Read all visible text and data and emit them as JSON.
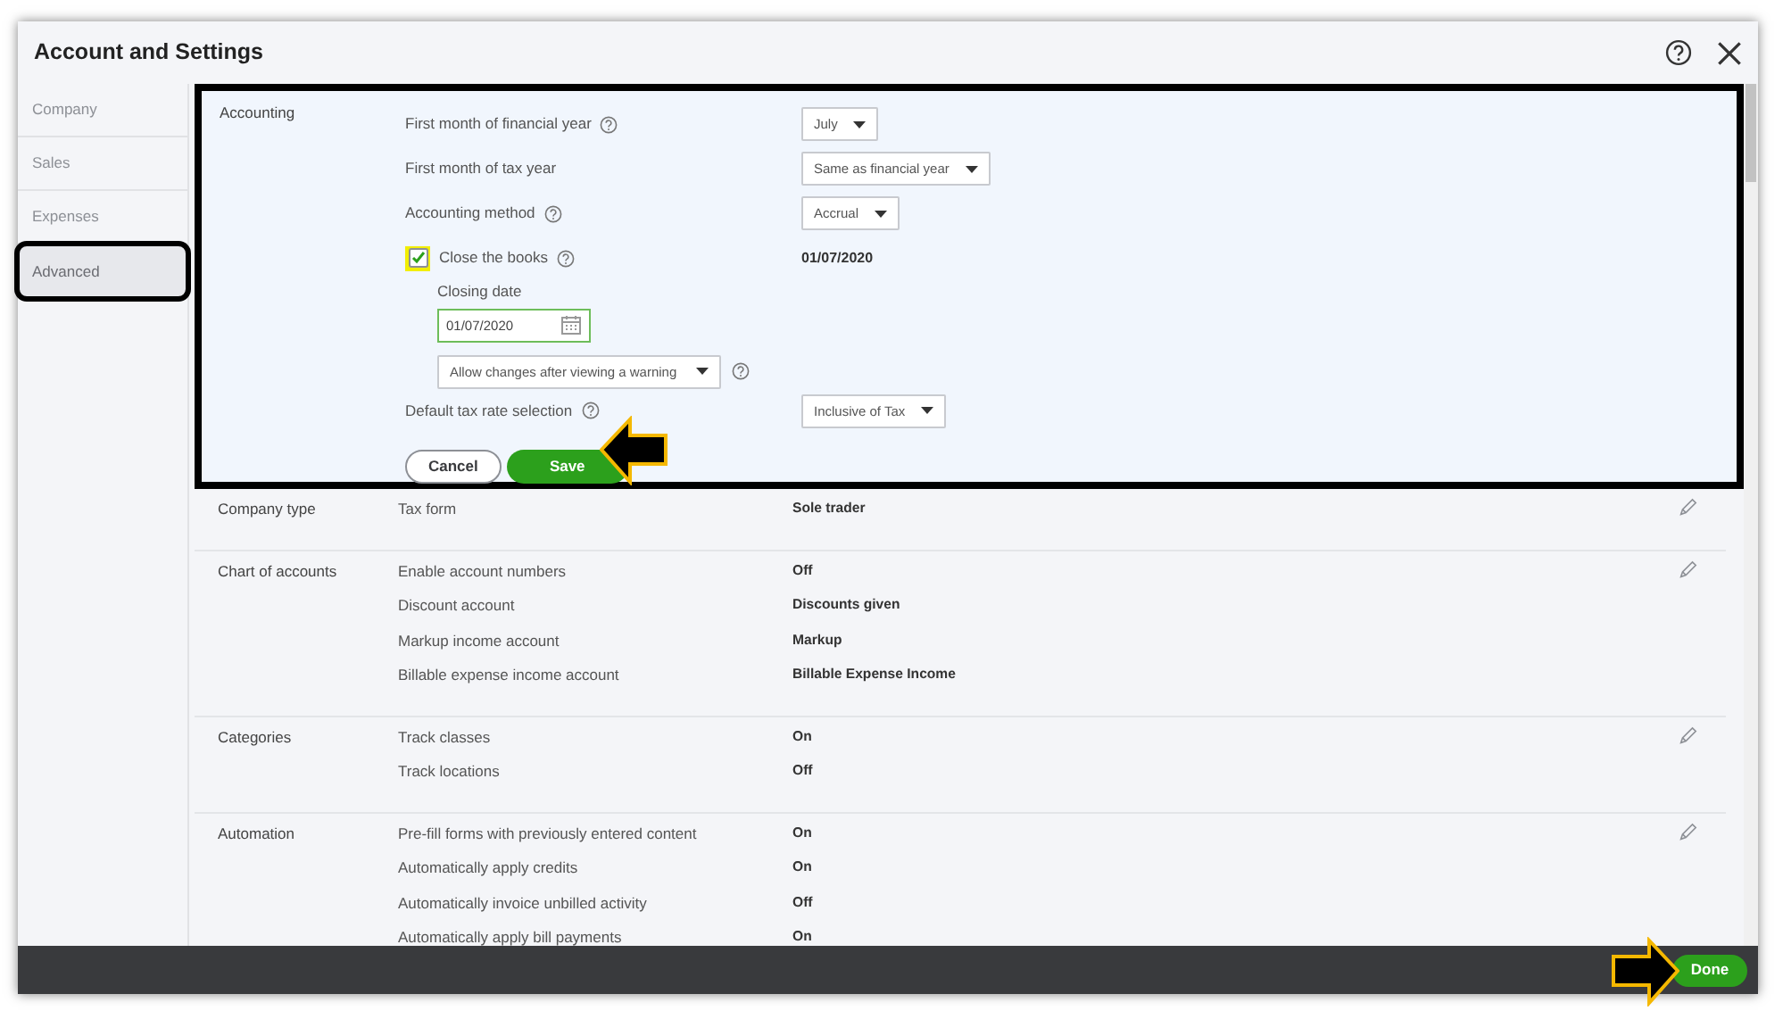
{
  "window": {
    "title": "Account and Settings"
  },
  "sidebar": {
    "items": [
      {
        "label": "Company",
        "selected": false,
        "highlighted": false
      },
      {
        "label": "Sales",
        "selected": false,
        "highlighted": false
      },
      {
        "label": "Expenses",
        "selected": false,
        "highlighted": false
      },
      {
        "label": "Advanced",
        "selected": true,
        "highlighted": true
      }
    ]
  },
  "accounting": {
    "label": "Accounting",
    "highlighted": true,
    "rows": [
      {
        "kind": "select",
        "label": "First month of financial year",
        "help": true,
        "value": "July"
      },
      {
        "kind": "select",
        "label": "First month of tax year",
        "help": false,
        "value": "Same as financial year"
      },
      {
        "kind": "select",
        "label": "Accounting method",
        "help": true,
        "value": "Accrual"
      },
      {
        "kind": "checkbox",
        "label": "Close the books",
        "help": true,
        "checked": true,
        "highlighted": true,
        "value": "01/07/2020",
        "closing_date_label": "Closing date",
        "closing_date": "01/07/2020",
        "option": "Allow changes after viewing a warning"
      },
      {
        "kind": "select",
        "label": "Default tax rate selection",
        "help": true,
        "value": "Inclusive of Tax"
      }
    ],
    "cancel": "Cancel",
    "save": "Save"
  },
  "sections": [
    {
      "label": "Company type",
      "rows": [
        {
          "label": "Tax form",
          "value": "Sole trader"
        }
      ]
    },
    {
      "label": "Chart of accounts",
      "rows": [
        {
          "label": "Enable account numbers",
          "value": "Off"
        },
        {
          "label": "Discount account",
          "value": "Discounts given"
        },
        {
          "label": "Markup income account",
          "value": "Markup"
        },
        {
          "label": "Billable expense income account",
          "value": "Billable Expense Income"
        }
      ]
    },
    {
      "label": "Categories",
      "rows": [
        {
          "label": "Track classes",
          "value": "On"
        },
        {
          "label": "Track locations",
          "value": "Off"
        }
      ]
    },
    {
      "label": "Automation",
      "rows": [
        {
          "label": "Pre-fill forms with previously entered content",
          "value": "On"
        },
        {
          "label": "Automatically apply credits",
          "value": "On"
        },
        {
          "label": "Automatically invoice unbilled activity",
          "value": "Off"
        },
        {
          "label": "Automatically apply bill payments",
          "value": "On"
        }
      ]
    }
  ],
  "footer": {
    "done": "Done"
  }
}
